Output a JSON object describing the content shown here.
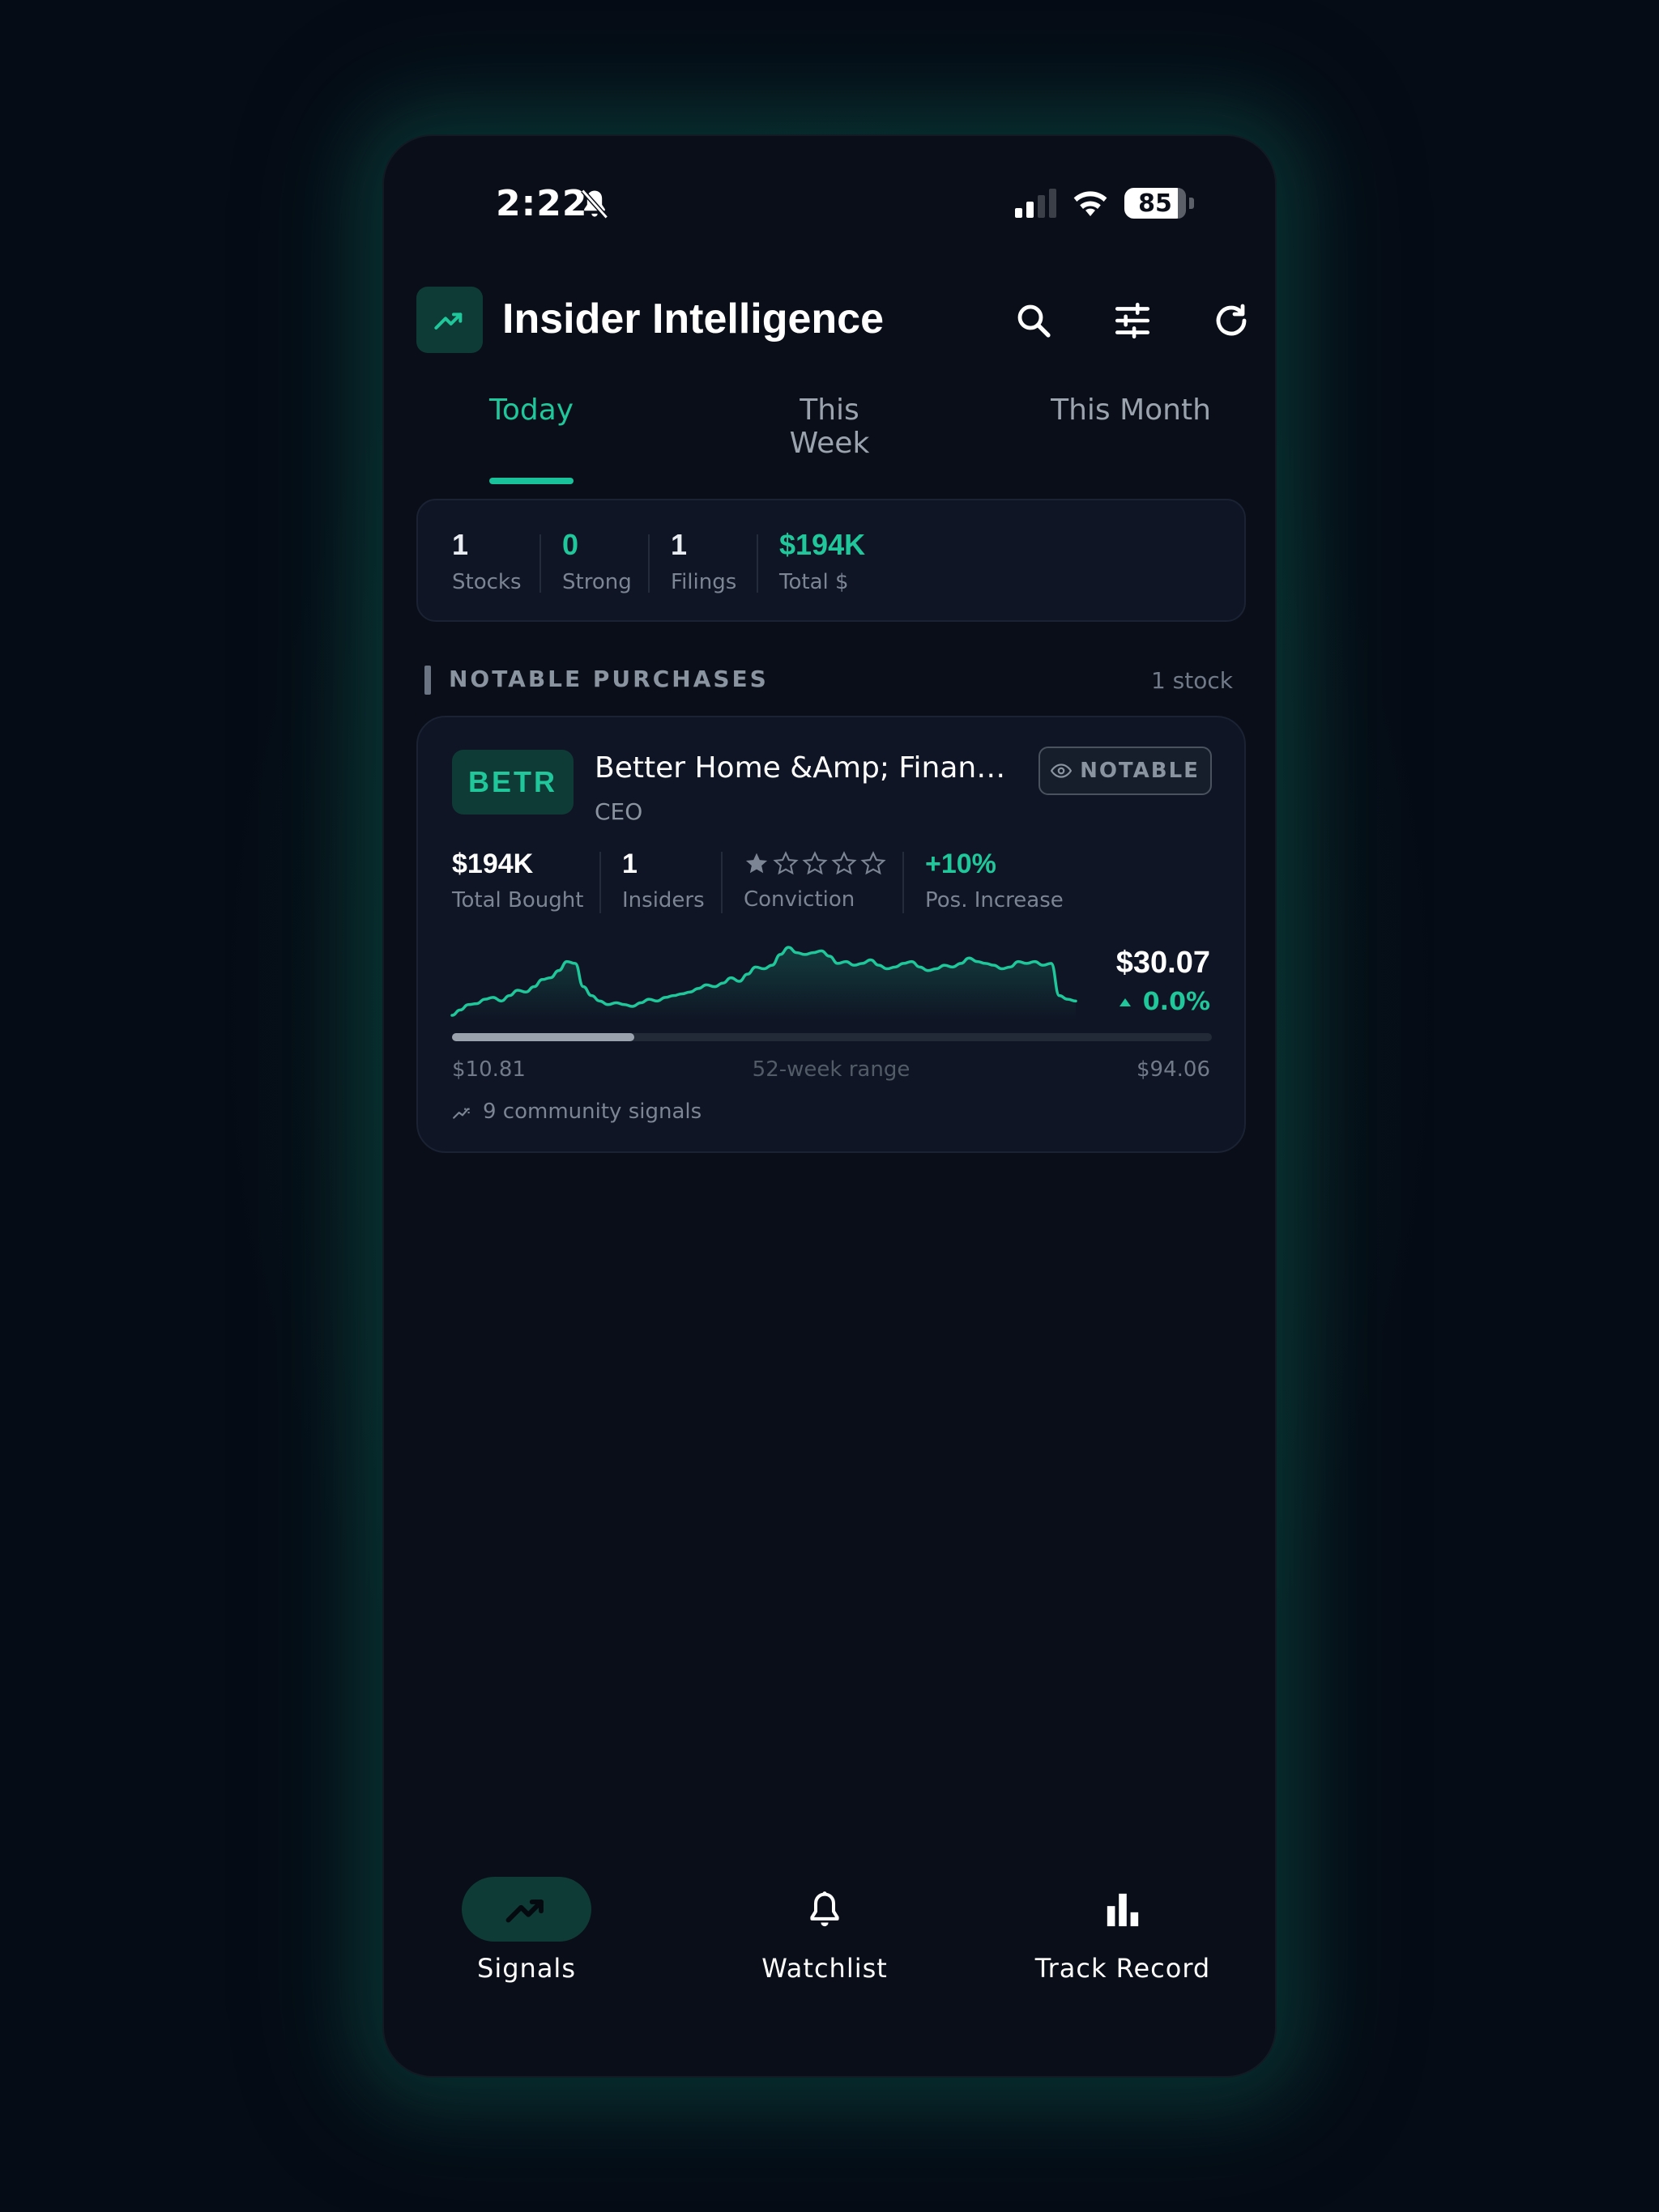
{
  "status_bar": {
    "time": "2:22",
    "battery": "85"
  },
  "header": {
    "title": "Insider Intelligence"
  },
  "tabs": [
    {
      "label": "Today",
      "active": true
    },
    {
      "label": "This Week",
      "active": false
    },
    {
      "label": "This Month",
      "active": false
    }
  ],
  "summary": [
    {
      "value": "1",
      "label": "Stocks"
    },
    {
      "value": "0",
      "label": "Strong"
    },
    {
      "value": "1",
      "label": "Filings"
    },
    {
      "value": "$194K",
      "label": "Total $"
    }
  ],
  "section": {
    "title": "NOTABLE PURCHASES",
    "count": "1 stock"
  },
  "card": {
    "ticker": "BETR",
    "company": "Better Home &Amp; Financ...",
    "role": "CEO",
    "badge": "NOTABLE",
    "metrics": {
      "total_bought": {
        "value": "$194K",
        "label": "Total Bought"
      },
      "insiders": {
        "value": "1",
        "label": "Insiders"
      },
      "conviction": {
        "stars": 1,
        "max": 5,
        "label": "Conviction"
      },
      "pos_increase": {
        "value": "+10%",
        "label": "Pos. Increase"
      }
    },
    "sparkline": [
      2,
      8,
      14,
      15,
      20,
      22,
      18,
      24,
      30,
      28,
      34,
      42,
      44,
      52,
      62,
      60,
      34,
      24,
      18,
      14,
      16,
      14,
      12,
      16,
      20,
      18,
      22,
      24,
      26,
      28,
      32,
      36,
      34,
      38,
      44,
      40,
      48,
      56,
      54,
      58,
      70,
      78,
      72,
      70,
      72,
      74,
      68,
      60,
      62,
      58,
      60,
      64,
      58,
      54,
      56,
      60,
      62,
      56,
      52,
      54,
      58,
      56,
      60,
      66,
      62,
      60,
      58,
      54,
      56,
      62,
      60,
      62,
      58,
      60,
      24,
      20,
      18
    ],
    "price": "$30.07",
    "change": "0.0%",
    "range": {
      "low": "$10.81",
      "label": "52-week range",
      "high": "$94.06",
      "position": 0.24
    },
    "community": "9 community signals"
  },
  "bottom_nav": [
    {
      "label": "Signals",
      "icon": "trending-up-icon",
      "active": true
    },
    {
      "label": "Watchlist",
      "icon": "bell-icon",
      "active": false
    },
    {
      "label": "Track Record",
      "icon": "bar-chart-icon",
      "active": false
    }
  ],
  "colors": {
    "accent": "#1fc79a",
    "background": "#0a0e18",
    "card": "#0f1524"
  }
}
